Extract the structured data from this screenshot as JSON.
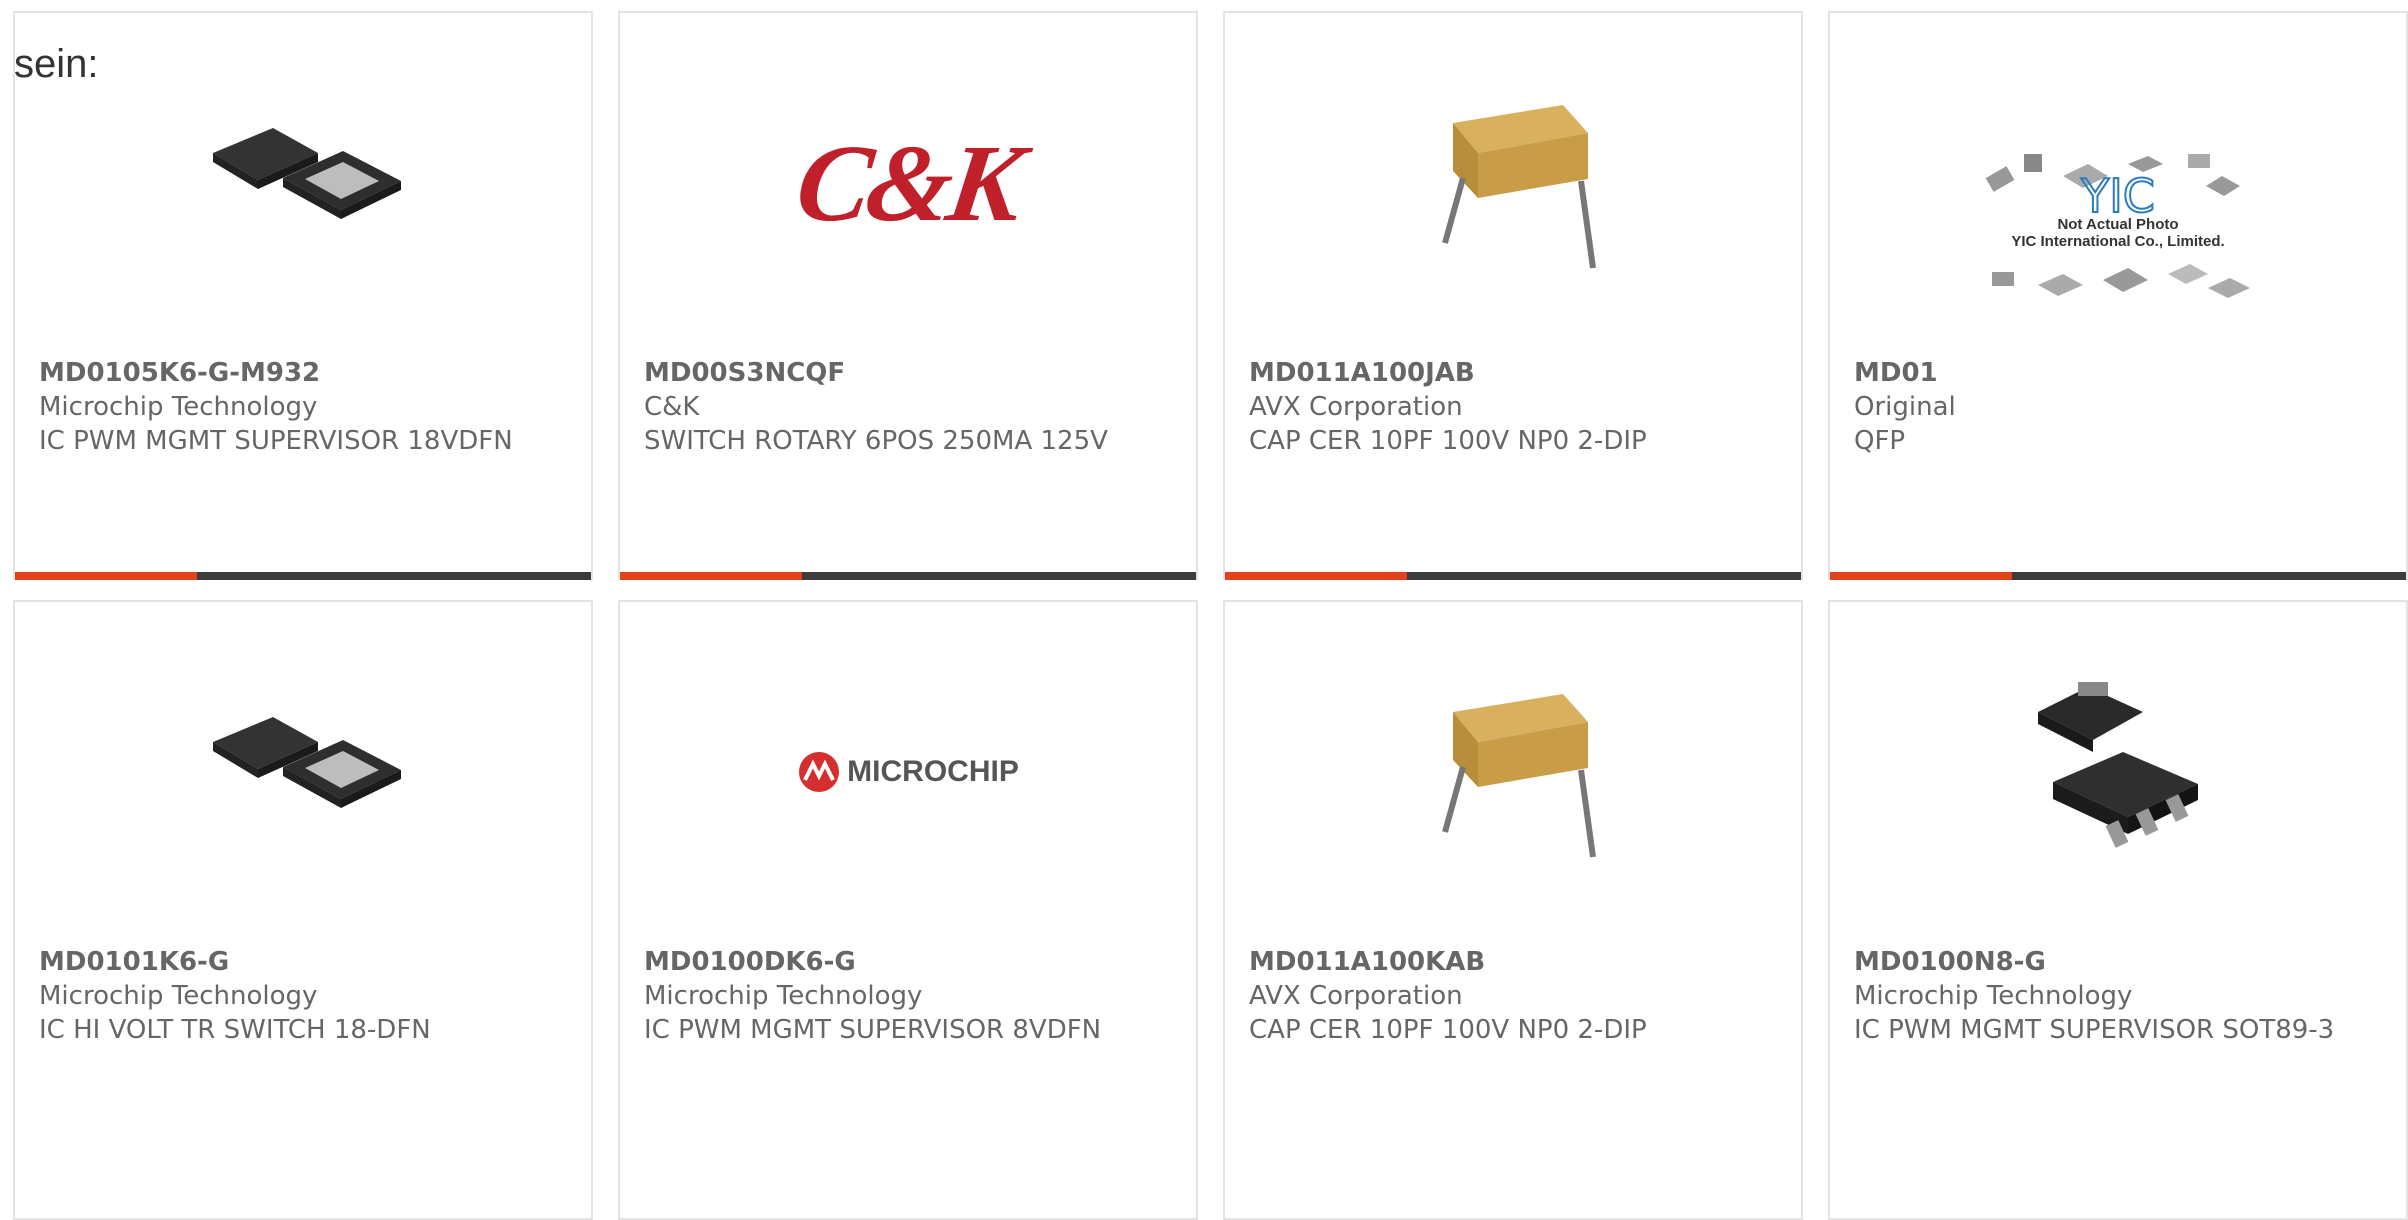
{
  "intro_text": "sein:",
  "products": [
    {
      "part_number": "MD0105K6-G-M932",
      "manufacturer": "Microchip Technology",
      "description": "IC PWM MGMT SUPERVISOR 18VDFN",
      "image": "dfn-chip-image"
    },
    {
      "part_number": "MD00S3NCQF",
      "manufacturer": "C&K",
      "description": "SWITCH ROTARY 6POS 250MA 125V",
      "image": "ck-logo",
      "logo_text": "C&K"
    },
    {
      "part_number": "MD011A100JAB",
      "manufacturer": "AVX Corporation",
      "description": "CAP CER 10PF 100V NP0 2-DIP",
      "image": "capacitor-image"
    },
    {
      "part_number": "MD01",
      "manufacturer": "Original",
      "description": "QFP",
      "image": "yic-placeholder",
      "placeholder_lines": [
        "Not Actual Photo",
        "YIC International Co., Limited."
      ]
    },
    {
      "part_number": "MD0101K6-G",
      "manufacturer": "Microchip Technology",
      "description": "IC HI VOLT TR SWITCH 18-DFN",
      "image": "dfn-chip-image"
    },
    {
      "part_number": "MD0100DK6-G",
      "manufacturer": "Microchip Technology",
      "description": "IC PWM MGMT SUPERVISOR 8VDFN",
      "image": "microchip-logo",
      "logo_text": "MICROCHIP"
    },
    {
      "part_number": "MD011A100KAB",
      "manufacturer": "AVX Corporation",
      "description": "CAP CER 10PF 100V NP0 2-DIP",
      "image": "capacitor-image"
    },
    {
      "part_number": "MD0100N8-G",
      "manufacturer": "Microchip Technology",
      "description": "IC PWM MGMT SUPERVISOR SOT89-3",
      "image": "sot89-image"
    }
  ],
  "colors": {
    "accent": "#e3431b",
    "bar": "#3c3c3c",
    "border": "#e3e3e3"
  }
}
